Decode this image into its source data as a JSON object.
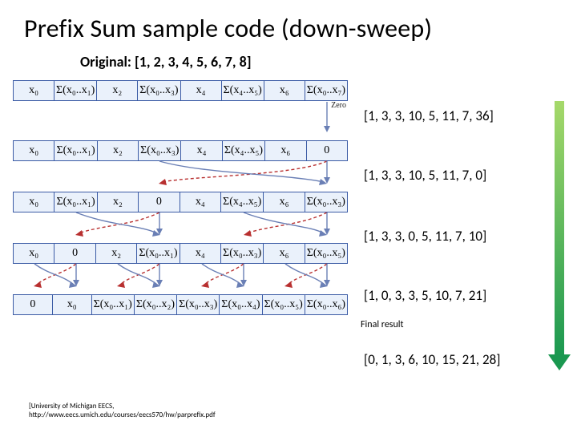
{
  "title": "Prefix Sum sample code (down-sweep)",
  "original_label": "Original:  [1, 2, 3, 4, 5, 6, 7, 8]",
  "zero_label": "Zero",
  "rows": {
    "r0": [
      "x₀",
      "Σ(x₀..x₁)",
      "x₂",
      "Σ(x₀..x₃)",
      "x₄",
      "Σ(x₄..x₅)",
      "x₆",
      "Σ(x₀..x₇)"
    ],
    "r1": [
      "x₀",
      "Σ(x₀..x₁)",
      "x₂",
      "Σ(x₀..x₃)",
      "x₄",
      "Σ(x₄..x₅)",
      "x₆",
      "0"
    ],
    "r2": [
      "x₀",
      "Σ(x₀..x₁)",
      "x₂",
      "0",
      "x₄",
      "Σ(x₄..x₅)",
      "x₆",
      "Σ(x₀..x₃)"
    ],
    "r3": [
      "x₀",
      "0",
      "x₂",
      "Σ(x₀..x₁)",
      "x₄",
      "Σ(x₀..x₃)",
      "x₆",
      "Σ(x₀..x₅)"
    ],
    "r4": [
      "0",
      "x₀",
      "Σ(x₀..x₁)",
      "Σ(x₀..x₂)",
      "Σ(x₀..x₃)",
      "Σ(x₀..x₄)",
      "Σ(x₀..x₅)",
      "Σ(x₀..x₆)"
    ]
  },
  "values": {
    "v0": "[1, 3, 3, 10, 5, 11, 7, 36]",
    "v1": "[1, 3, 3, 10, 5, 11, 7,   0]",
    "v2": "[1, 3, 3, 0,   5, 11, 7, 10]",
    "v3": "[1, 0, 3, 3,   5, 10, 7, 21]",
    "v4": "[0, 1, 3, 6, 10, 15, 21, 28]"
  },
  "final_result_label": "Final result",
  "credit_line1": "[University of Michigan EECS,",
  "credit_line2": "http://www.eecs.umich.edu/courses/eecs570/hw/parprefix.pdf"
}
